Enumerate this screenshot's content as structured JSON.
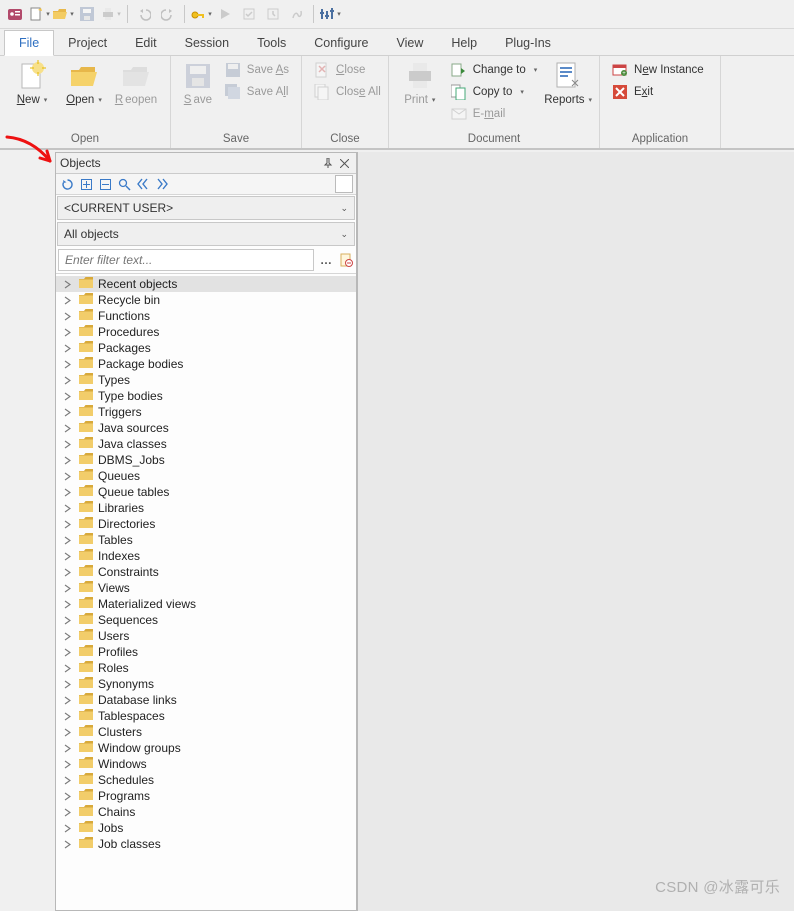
{
  "qat_icons": [
    "app",
    "new",
    "open",
    "save",
    "print",
    "sep",
    "undo",
    "redo",
    "sep",
    "key",
    "run",
    "commit",
    "rollback",
    "break",
    "sep",
    "settings"
  ],
  "menus": [
    {
      "k": "file",
      "label": "File",
      "cls": "file"
    },
    {
      "k": "project",
      "label": "Project"
    },
    {
      "k": "edit",
      "label": "Edit"
    },
    {
      "k": "session",
      "label": "Session"
    },
    {
      "k": "tools",
      "label": "Tools"
    },
    {
      "k": "configure",
      "label": "Configure"
    },
    {
      "k": "view",
      "label": "View"
    },
    {
      "k": "help",
      "label": "Help"
    },
    {
      "k": "plugins",
      "label": "Plug-Ins"
    }
  ],
  "ribbon": {
    "open": {
      "title": "Open",
      "new": "New",
      "open": "Open",
      "reopen": "Reopen"
    },
    "save": {
      "title": "Save",
      "save": "Save",
      "saveas": "Save As",
      "saveall": "Save All"
    },
    "close": {
      "title": "Close",
      "close": "Close",
      "closeall": "Close All"
    },
    "document": {
      "title": "Document",
      "print": "Print",
      "changeto": "Change to",
      "copyto": "Copy to",
      "email": "E-mail",
      "reports": "Reports"
    },
    "application": {
      "title": "Application",
      "newinst": "New Instance",
      "exit": "Exit"
    }
  },
  "panel": {
    "title": "Objects",
    "user": "<CURRENT USER>",
    "scope": "All objects",
    "filter_ph": "Enter filter text..."
  },
  "tree": [
    {
      "label": "Recent objects",
      "sel": true
    },
    {
      "label": "Recycle bin"
    },
    {
      "label": "Functions"
    },
    {
      "label": "Procedures"
    },
    {
      "label": "Packages"
    },
    {
      "label": "Package bodies"
    },
    {
      "label": "Types"
    },
    {
      "label": "Type bodies"
    },
    {
      "label": "Triggers"
    },
    {
      "label": "Java sources"
    },
    {
      "label": "Java classes"
    },
    {
      "label": "DBMS_Jobs"
    },
    {
      "label": "Queues"
    },
    {
      "label": "Queue tables"
    },
    {
      "label": "Libraries"
    },
    {
      "label": "Directories"
    },
    {
      "label": "Tables"
    },
    {
      "label": "Indexes"
    },
    {
      "label": "Constraints"
    },
    {
      "label": "Views"
    },
    {
      "label": "Materialized views"
    },
    {
      "label": "Sequences"
    },
    {
      "label": "Users"
    },
    {
      "label": "Profiles"
    },
    {
      "label": "Roles"
    },
    {
      "label": "Synonyms"
    },
    {
      "label": "Database links"
    },
    {
      "label": "Tablespaces"
    },
    {
      "label": "Clusters"
    },
    {
      "label": "Window groups"
    },
    {
      "label": "Windows"
    },
    {
      "label": "Schedules"
    },
    {
      "label": "Programs"
    },
    {
      "label": "Chains"
    },
    {
      "label": "Jobs"
    },
    {
      "label": "Job classes"
    }
  ],
  "watermark": "CSDN @冰露可乐"
}
